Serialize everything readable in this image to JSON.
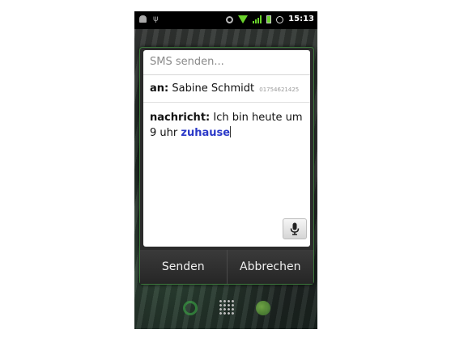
{
  "statusbar": {
    "time": "15:13",
    "icons": [
      "android-icon",
      "usb-icon",
      "sync-icon",
      "wifi-icon",
      "signal-icon",
      "battery-icon",
      "alarm-icon"
    ]
  },
  "dialog": {
    "title": "SMS senden...",
    "to_label": "an:",
    "recipient_name": "Sabine Schmidt",
    "recipient_number": "01754621425",
    "message_label": "nachricht:",
    "message_text": "Ich bin heute um 9 uhr",
    "message_highlight": "zuhause",
    "send_label": "Senden",
    "cancel_label": "Abbrechen"
  },
  "dock": {
    "icons": [
      "phone-icon",
      "app-grid-icon",
      "browser-icon"
    ]
  },
  "colors": {
    "highlight": "#2b39c8",
    "status_green": "#6ad22b",
    "dialog_border": "#3d7a3d"
  }
}
